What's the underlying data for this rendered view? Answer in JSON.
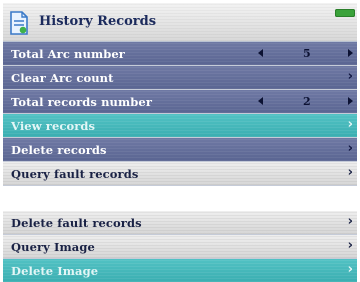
{
  "header": {
    "title": "History Records",
    "icon": "document-icon",
    "status_icon": "battery-icon",
    "battery_color": "#3aa23a"
  },
  "menu_top": [
    {
      "label": "Total Arc number",
      "value": "5",
      "type": "stepper"
    },
    {
      "label": "Clear Arc count",
      "type": "link"
    },
    {
      "label": "Total records number",
      "value": "2",
      "type": "stepper"
    },
    {
      "label": "View records",
      "type": "link",
      "selected": true
    },
    {
      "label": "Delete records",
      "type": "link"
    },
    {
      "label": "Query fault records",
      "type": "link"
    }
  ],
  "menu_bottom": [
    {
      "label": "Delete fault records",
      "type": "link"
    },
    {
      "label": "Query Image",
      "type": "link"
    },
    {
      "label": "Delete Image",
      "type": "link",
      "selected": true
    }
  ],
  "glyphs": {
    "chevron": "›"
  },
  "colors": {
    "row_blue": "#616c99",
    "row_selected": "#45b8ba",
    "row_light": "#e4e4e4",
    "title_text": "#1b2a5c"
  }
}
